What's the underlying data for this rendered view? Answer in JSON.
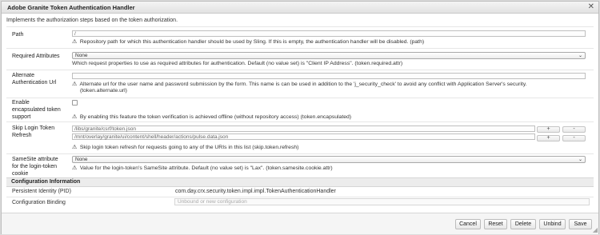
{
  "dialog": {
    "title": "Adobe Granite Token Authentication Handler",
    "close_label": "✕",
    "description": "Implements the authorization steps based on the token authorization."
  },
  "fields": {
    "path": {
      "label": "Path",
      "value": "/",
      "help": "Repository path for which this authentication handler should be used by Sling. If this is empty, the authentication handler will be disabled. (path)"
    },
    "required_attributes": {
      "label": "Required Attributes",
      "selected": "None",
      "help": "Which request properties to use as required attributes for authentication. Default (no value set) is \"Client IP Address\". (token.required.attr)"
    },
    "alternate_url": {
      "label_line1": "Alternate",
      "label_line2": "Authentication Url",
      "value": "",
      "help_line1": "Alternate url for the user name and password submission by the form. This name is can be used in addition to the 'j_security_check' to avoid any conflict with Application Server's security.",
      "help_line2": "(token.alternate.url)"
    },
    "encapsulated": {
      "label_line1": "Enable",
      "label_line2": "encapsulated token",
      "label_line3": "support",
      "checked": false,
      "help": "By enabling this feature the token verification is achieved offline (without repository access) (token.encapsulated)"
    },
    "skip_refresh": {
      "label_line1": "Skip Login Token",
      "label_line2": "Refresh",
      "values": [
        "/libs/granite/csrf/token.json",
        "/mnt/overlay/granite/ui/content/shell/header/actions/pulse.data.json"
      ],
      "plus_label": "+",
      "minus_label": "-",
      "help": "Skip login token refresh for requests going to any of the URIs in this list (skip.token.refresh)"
    },
    "samesite": {
      "label_line1": "SameSite attribute",
      "label_line2": "for the login-token",
      "label_line3": "cookie",
      "selected": "None",
      "help": "Value for the login-token's SameSite attribute. Default (no value set) is \"Lax\". (token.samesite.cookie.attr)"
    }
  },
  "config_info": {
    "title": "Configuration Information",
    "pid_label": "Persistent Identity (PID)",
    "pid_value": "com.day.crx.security.token.impl.impl.TokenAuthenticationHandler",
    "binding_label": "Configuration Binding",
    "binding_placeholder": "Unbound or new configuration"
  },
  "footer": {
    "cancel": "Cancel",
    "reset": "Reset",
    "delete": "Delete",
    "unbind": "Unbind",
    "save": "Save"
  },
  "icons": {
    "warning": "⚠",
    "chevron": "⌄"
  }
}
